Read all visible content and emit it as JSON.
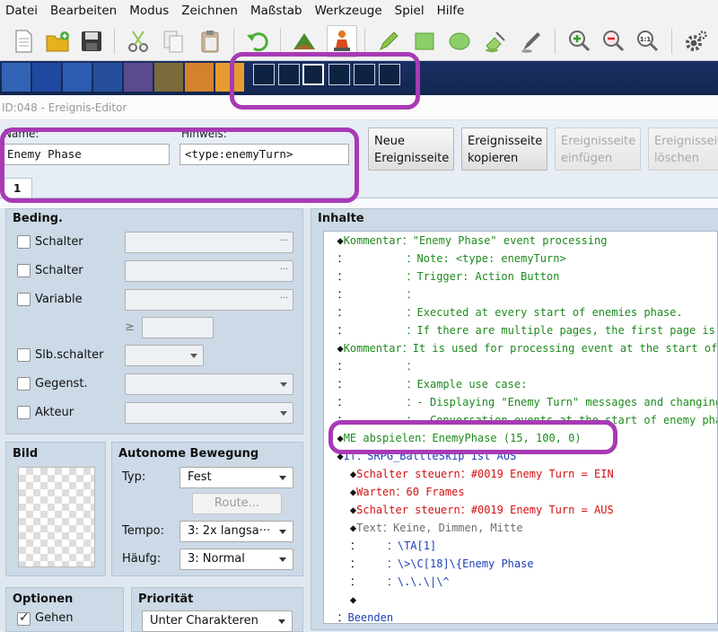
{
  "menu": [
    "Datei",
    "Bearbeiten",
    "Modus",
    "Zeichnen",
    "Maßstab",
    "Werkzeuge",
    "Spiel",
    "Hilfe"
  ],
  "toolbar_icons": [
    "new-icon",
    "open-folder-icon",
    "save-icon",
    "cut-icon",
    "copy-icon",
    "paste-icon",
    "undo-icon",
    "map-mode-icon",
    "event-mode-icon",
    "pencil-icon",
    "rectangle-icon",
    "ellipse-icon",
    "fill-icon",
    "shadow-pen-icon",
    "zoom-in-icon",
    "zoom-out-icon",
    "zoom-actual-icon",
    "settings-icon"
  ],
  "editor_title": "ID:048 - Ereignis-Editor",
  "name_label": "Name:",
  "name_value": "Enemy Phase",
  "note_label": "Hinweis:",
  "note_value": "<type:enemyTurn>",
  "buttons": {
    "new_page_1": "Neue",
    "new_page_2": "Ereignisseite",
    "copy_page_1": "Ereignisseite",
    "copy_page_2": "kopieren",
    "paste_page_1": "Ereignisseite",
    "paste_page_2": "einfügen",
    "delete_page_1": "Ereignisseite",
    "delete_page_2": "löschen"
  },
  "page_tab": "1",
  "conditions": {
    "title": "Beding.",
    "switch1": "Schalter",
    "switch2": "Schalter",
    "variable": "Variable",
    "gte": "≥",
    "self_switch": "Slb.schalter",
    "item": "Gegenst.",
    "actor": "Akteur",
    "dots": "···"
  },
  "image": {
    "title": "Bild"
  },
  "autonomous": {
    "title": "Autonome Bewegung",
    "type_label": "Typ:",
    "type_value": "Fest",
    "route_label": "Route...",
    "speed_label": "Tempo:",
    "speed_value": "3: 2x langsa···",
    "freq_label": "Häufg:",
    "freq_value": "3: Normal"
  },
  "options": {
    "title": "Optionen",
    "walk": "Gehen"
  },
  "priority": {
    "title": "Priorität",
    "value": "Unter Charakteren"
  },
  "contents": {
    "title": "Inhalte",
    "lines": [
      {
        "indent": "",
        "bullet": "◆",
        "cmd": "Kommentar",
        "sep": "：",
        "text": "\"Enemy Phase\" event processing",
        "color": "g"
      },
      {
        "indent": "",
        "bullet": "：",
        "cmd": "         ",
        "sep": "：",
        "text": "Note: <type: enemyTurn>",
        "color": "g"
      },
      {
        "indent": "",
        "bullet": "：",
        "cmd": "         ",
        "sep": "：",
        "text": "Trigger: Action Button",
        "color": "g"
      },
      {
        "indent": "",
        "bullet": "：",
        "cmd": "         ",
        "sep": "：",
        "text": "",
        "color": "g"
      },
      {
        "indent": "",
        "bullet": "：",
        "cmd": "         ",
        "sep": "：",
        "text": "Executed at every start of enemies phase.",
        "color": "g"
      },
      {
        "indent": "",
        "bullet": "：",
        "cmd": "         ",
        "sep": "：",
        "text": "If there are multiple pages, the first page is used",
        "color": "g"
      },
      {
        "indent": "",
        "bullet": "◆",
        "cmd": "Kommentar",
        "sep": "：",
        "text": "It is used for processing event at the start of the",
        "color": "g"
      },
      {
        "indent": "",
        "bullet": "：",
        "cmd": "         ",
        "sep": "：",
        "text": "",
        "color": "g"
      },
      {
        "indent": "",
        "bullet": "：",
        "cmd": "         ",
        "sep": "：",
        "text": "Example use case:",
        "color": "g"
      },
      {
        "indent": "",
        "bullet": "：",
        "cmd": "         ",
        "sep": "：",
        "text": "- Displaying \"Enemy Turn\" messages and changing BGM",
        "color": "g"
      },
      {
        "indent": "",
        "bullet": "：",
        "cmd": "         ",
        "sep": "：",
        "text": "- Conversation events at the start of enemy phase,",
        "color": "g"
      },
      {
        "indent": "",
        "bullet": "◆",
        "cmd": "ME abspielen",
        "sep": "：",
        "text": "EnemyPhase (15, 100, 0)",
        "color": "g"
      },
      {
        "indent": "",
        "bullet": "◆",
        "cmd": "If",
        "sep": "：",
        "text": "SRPG_BattleSkip ist AUS",
        "color": "b"
      },
      {
        "indent": "  ",
        "bullet": "◆",
        "cmd": "Schalter steuern",
        "sep": "：",
        "text": "#0019 Enemy Turn = EIN",
        "color": "r"
      },
      {
        "indent": "  ",
        "bullet": "◆",
        "cmd": "Warten",
        "sep": "：",
        "text": "60 Frames",
        "color": "r"
      },
      {
        "indent": "  ",
        "bullet": "◆",
        "cmd": "Schalter steuern",
        "sep": "：",
        "text": "#0019 Enemy Turn = AUS",
        "color": "r"
      },
      {
        "indent": "  ",
        "bullet": "◆",
        "cmd": "Text",
        "sep": "：",
        "text": "Keine, Dimmen, Mitte",
        "color": "s"
      },
      {
        "indent": "  ",
        "bullet": "：",
        "cmd": "    ",
        "sep": "：",
        "text": "\\TA[1]",
        "color": "b"
      },
      {
        "indent": "  ",
        "bullet": "：",
        "cmd": "    ",
        "sep": "：",
        "text": "\\>\\C[18]\\{Enemy Phase",
        "color": "b"
      },
      {
        "indent": "  ",
        "bullet": "：",
        "cmd": "    ",
        "sep": "：",
        "text": "\\.\\.\\|\\^",
        "color": "b"
      },
      {
        "indent": "  ",
        "bullet": "◆",
        "cmd": "",
        "sep": "",
        "text": "",
        "color": "k"
      },
      {
        "indent": "",
        "bullet": "：",
        "cmd": "Beenden",
        "sep": "",
        "text": "",
        "color": "b"
      }
    ]
  },
  "colors": {
    "highlight": "#a83ab5",
    "comment": "#1d8a1d",
    "flow": "#1c3fb8",
    "control": "#d31111"
  }
}
